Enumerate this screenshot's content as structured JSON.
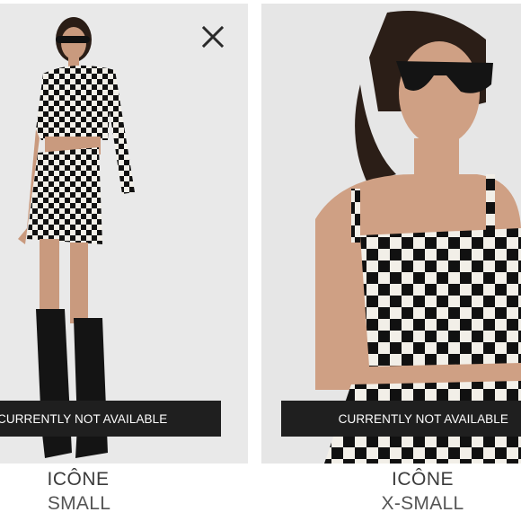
{
  "products": [
    {
      "brand": "ICÔNE",
      "size": "SMALL",
      "availability": "CURRENTLY NOT AVAILABLE",
      "image_alt": "Model in checkered black and white crop jacket, crop top and mini skirt with black cowboy boots"
    },
    {
      "brand": "ICÔNE",
      "size": "X-SMALL",
      "availability": "CURRENTLY NOT AVAILABLE",
      "image_alt": "Model in checkered black and white crop top with sunglasses"
    }
  ],
  "close": {
    "icon": "close-icon"
  },
  "colors": {
    "banner": "#1f1f1f",
    "brand_text": "#3b3b3b",
    "size_text": "#555555"
  }
}
